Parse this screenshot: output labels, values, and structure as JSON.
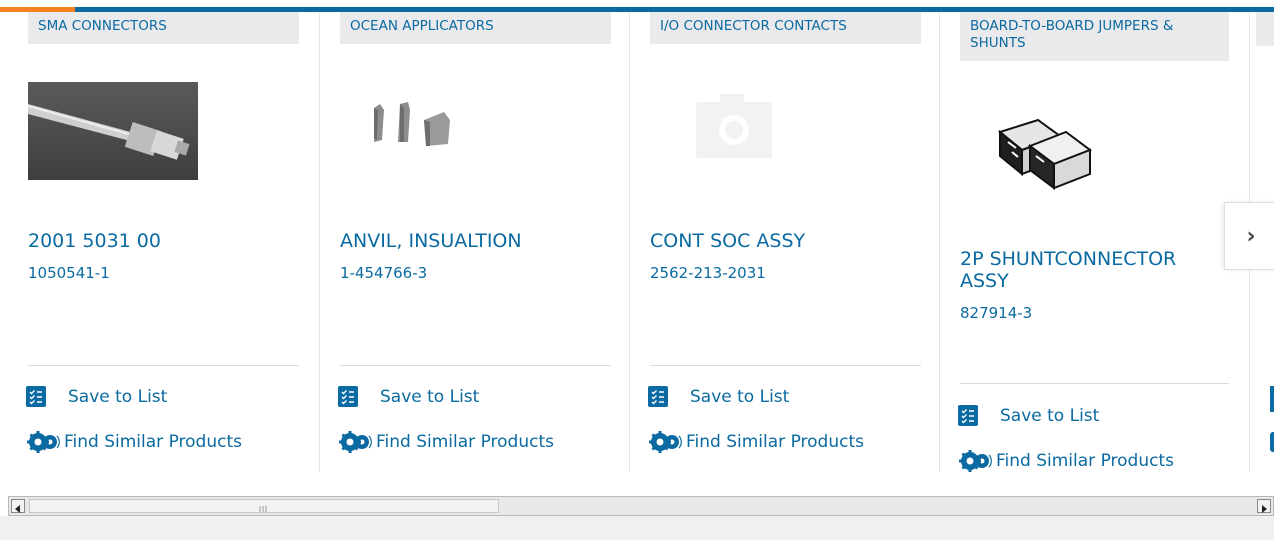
{
  "cards": [
    {
      "category": "SMA CONNECTORS",
      "title": "2001 5031 00",
      "part_number": "1050541-1"
    },
    {
      "category": "OCEAN APPLICATORS",
      "title": "ANVIL, INSUALTION",
      "part_number": "1-454766-3"
    },
    {
      "category": "I/O CONNECTOR CONTACTS",
      "title": "CONT SOC ASSY",
      "part_number": "2562-213-2031"
    },
    {
      "category": "BOARD-TO-BOARD JUMPERS & SHUNTS",
      "title": "2P SHUNTCONNECTOR ASSY",
      "part_number": "827914-3"
    }
  ],
  "actions": {
    "save_label": "Save to List",
    "find_label": "Find Similar Products"
  },
  "next_button": {
    "label": "›"
  },
  "colors": {
    "brand": "#0a6aa1",
    "accent": "#f58220",
    "category_bg": "#eaeaec"
  },
  "icons": {
    "save": "checklist-icon",
    "find": "gears-icon",
    "next": "chevron-right-icon"
  }
}
